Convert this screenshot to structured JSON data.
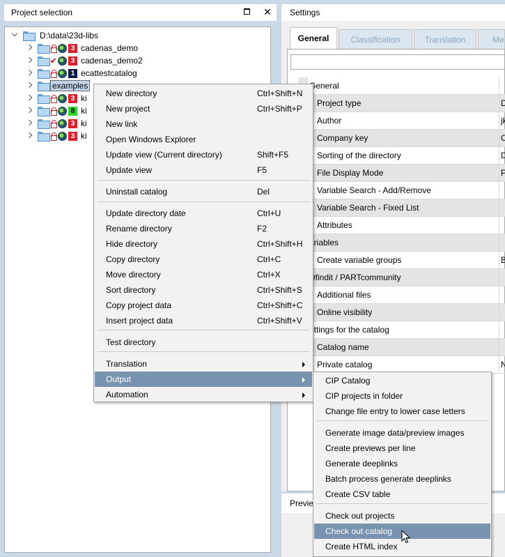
{
  "left_panel": {
    "title": "Project selection",
    "close_glyph": "✕",
    "tree": {
      "root": "D:\\data\\23d-libs",
      "items": [
        {
          "label": "cadenas_demo",
          "badge": "3",
          "badge_color": "#e0202a",
          "marker": "lock"
        },
        {
          "label": "cadenas_demo2",
          "badge": "3",
          "badge_color": "#e0202a",
          "marker": "check"
        },
        {
          "label": "ecattestcatalog",
          "badge": "1",
          "badge_color": "#0f1d4a",
          "marker": "lock"
        },
        {
          "label": "examples",
          "badge": "",
          "marker": "none",
          "selected": true
        },
        {
          "label": "ki",
          "badge": "3",
          "badge_color": "#e0202a",
          "marker": "lock"
        },
        {
          "label": "ki",
          "badge": "8",
          "badge_color": "#2fd22f",
          "marker": "lock"
        },
        {
          "label": "ki",
          "badge": "3",
          "badge_color": "#e0202a",
          "marker": "lock"
        },
        {
          "label": "ki",
          "badge": "3",
          "badge_color": "#e0202a",
          "marker": "lock"
        }
      ]
    }
  },
  "right_panel": {
    "title": "Settings",
    "tabs": [
      "General",
      "Classification",
      "Translation",
      "Me"
    ],
    "properties": [
      {
        "name": "General",
        "value": "",
        "grey": false,
        "indent": "section"
      },
      {
        "name": "Project type",
        "value": "D",
        "grey": true,
        "indent": "item"
      },
      {
        "name": "Author",
        "value": "jk",
        "grey": false,
        "indent": "item"
      },
      {
        "name": "Company key",
        "value": "C",
        "grey": true,
        "indent": "item"
      },
      {
        "name": "Sorting of the directory",
        "value": "D",
        "grey": false,
        "indent": "item"
      },
      {
        "name": "File Display Mode",
        "value": "P",
        "grey": true,
        "indent": "item"
      },
      {
        "name": "Variable Search - Add/Remove",
        "value": "",
        "grey": false,
        "indent": "item"
      },
      {
        "name": "Variable Search - Fixed List",
        "value": "",
        "grey": true,
        "indent": "item"
      },
      {
        "name": "Attributes",
        "value": "",
        "grey": false,
        "indent": "item"
      },
      {
        "name": "ariables",
        "value": "",
        "grey": true,
        "indent": "section"
      },
      {
        "name": "Create variable groups",
        "value": "B",
        "grey": false,
        "indent": "item"
      },
      {
        "name": "Dfindit / PARTcommunity",
        "value": "",
        "grey": true,
        "indent": "section"
      },
      {
        "name": "Additional files",
        "value": "",
        "grey": false,
        "indent": "item"
      },
      {
        "name": "Online visibility",
        "value": "",
        "grey": true,
        "indent": "item"
      },
      {
        "name": "ettings for the catalog",
        "value": "",
        "grey": false,
        "indent": "section"
      },
      {
        "name": "Catalog name",
        "value": "",
        "grey": true,
        "indent": "item"
      },
      {
        "name": "Private catalog",
        "value": "N",
        "grey": false,
        "indent": "item"
      }
    ],
    "preview_title": "Previe"
  },
  "context_menu": {
    "items": [
      {
        "label": "New directory",
        "shortcut": "Ctrl+Shift+N"
      },
      {
        "label": "New project",
        "shortcut": "Ctrl+Shift+P"
      },
      {
        "label": "New link",
        "shortcut": ""
      },
      {
        "label": "Open Windows Explorer",
        "shortcut": ""
      },
      {
        "label": "Update view (Current directory)",
        "shortcut": "Shift+F5"
      },
      {
        "label": "Update view",
        "shortcut": "F5"
      },
      {
        "label": "Uninstall catalog",
        "shortcut": "Del"
      },
      {
        "label": "Update directory date",
        "shortcut": "Ctrl+U"
      },
      {
        "label": "Rename directory",
        "shortcut": "F2"
      },
      {
        "label": "Hide directory",
        "shortcut": "Ctrl+Shift+H"
      },
      {
        "label": "Copy directory",
        "shortcut": "Ctrl+C"
      },
      {
        "label": "Move directory",
        "shortcut": "Ctrl+X"
      },
      {
        "label": "Sort directory",
        "shortcut": "Ctrl+Shift+S"
      },
      {
        "label": "Copy project data",
        "shortcut": "Ctrl+Shift+C"
      },
      {
        "label": "Insert project data",
        "shortcut": "Ctrl+Shift+V"
      },
      {
        "label": "Test directory",
        "shortcut": ""
      },
      {
        "label": "Translation",
        "shortcut": "",
        "submenu": true
      },
      {
        "label": "Output",
        "shortcut": "",
        "submenu": true,
        "highlighted": true
      },
      {
        "label": "Automation",
        "shortcut": "",
        "submenu": true
      }
    ]
  },
  "output_submenu": {
    "items": [
      {
        "label": "CIP Catalog"
      },
      {
        "label": "CIP projects in folder"
      },
      {
        "label": "Change file entry to lower case letters"
      },
      {
        "label": "Generate image data/preview images"
      },
      {
        "label": "Create previews per line"
      },
      {
        "label": "Generate deeplinks"
      },
      {
        "label": "Batch process generate deeplinks"
      },
      {
        "label": "Create CSV table"
      },
      {
        "label": "Check out projects"
      },
      {
        "label": "Check out catalog",
        "highlighted": true
      },
      {
        "label": "Create HTML index"
      }
    ]
  }
}
